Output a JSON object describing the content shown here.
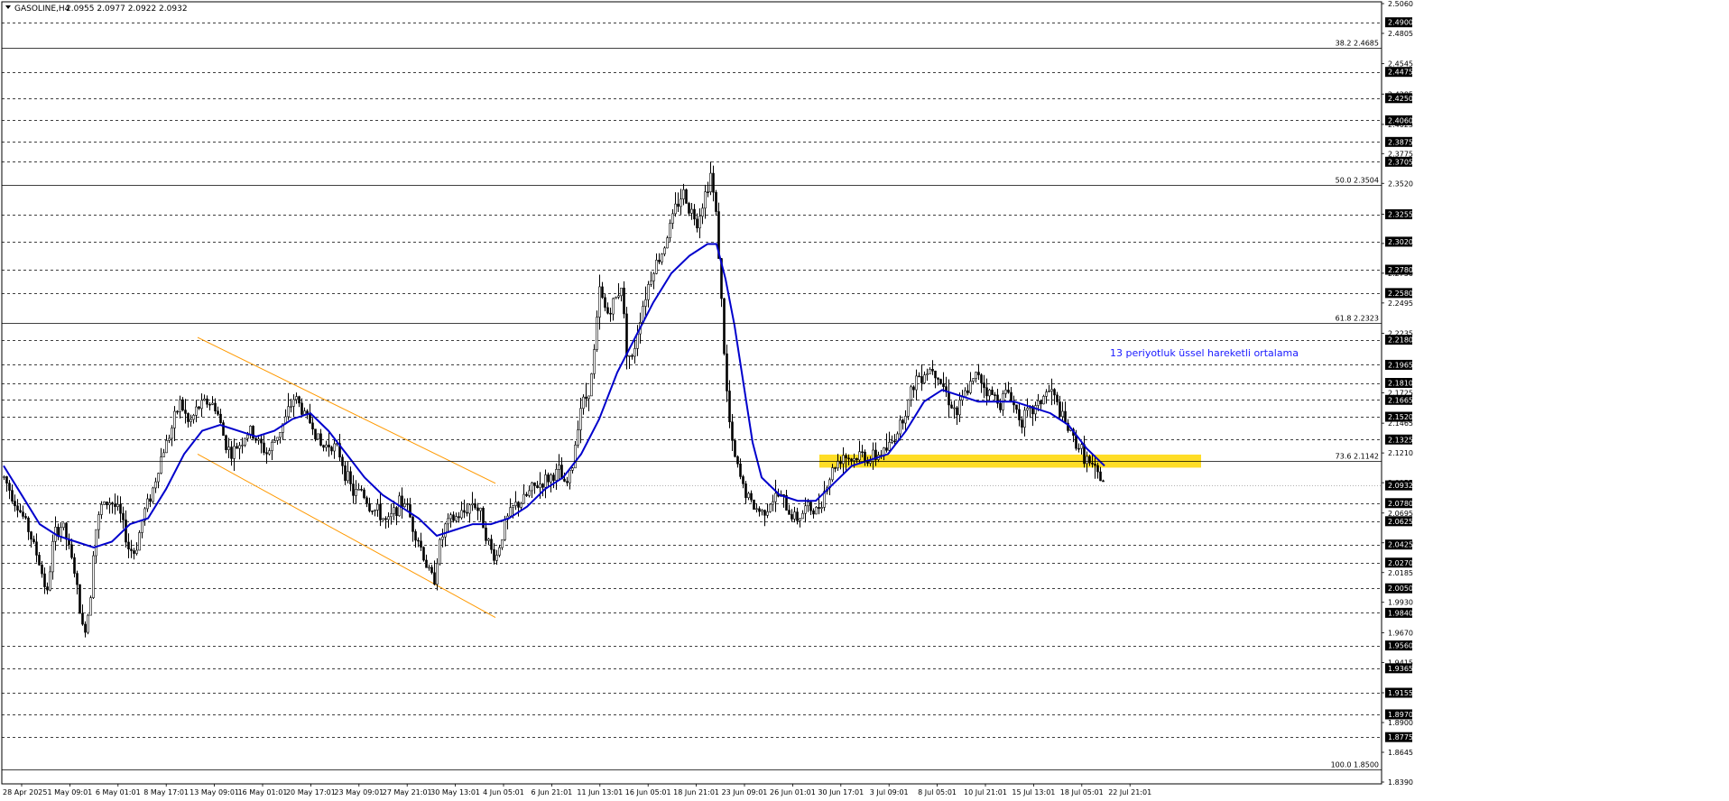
{
  "header": {
    "symbol": "GASOLINE,H4",
    "ohlc": "2.0955 2.0977 2.0922 2.0932"
  },
  "annotation_text": "13 periyotluk üssel hareketli ortalama",
  "colors": {
    "candle": "#000000",
    "ema": "#0000cc",
    "channel": "#ff9900",
    "zone": "#ffd700",
    "annotation": "#1a1aff",
    "grid": "#000000"
  },
  "chart_data": {
    "type": "candlestick",
    "symbol": "GASOLINE",
    "timeframe": "H4",
    "ylim": [
      1.839,
      2.506
    ],
    "price_axis_ticks": [
      "2.5060",
      "2.4805",
      "2.4545",
      "2.4285",
      "2.4025",
      "2.3775",
      "2.3520",
      "2.3255",
      "2.3005",
      "2.2750",
      "2.2495",
      "2.2235",
      "2.1725",
      "2.1465",
      "2.1210",
      "2.0955",
      "2.0695",
      "2.0440",
      "2.0185",
      "1.9930",
      "1.9670",
      "1.9415",
      "1.9155",
      "1.8900",
      "1.8645",
      "1.8390"
    ],
    "price_levels": [
      2.49,
      2.4475,
      2.425,
      2.406,
      2.3875,
      2.3705,
      2.3255,
      2.302,
      2.278,
      2.258,
      2.218,
      2.1965,
      2.181,
      2.1665,
      2.152,
      2.1325,
      2.078,
      2.0625,
      2.0425,
      2.027,
      2.005,
      1.984,
      1.956,
      1.9365,
      1.9155,
      1.897,
      1.8775
    ],
    "level_labels": [
      "2.4900",
      "2.4475",
      "2.4250",
      "2.4060",
      "2.3875",
      "2.3705",
      "2.3255",
      "2.3020",
      "2.2780",
      "2.2580",
      "2.2180",
      "2.1965",
      "2.1810",
      "2.1665",
      "2.1520",
      "2.1325",
      "2.0780",
      "2.0625",
      "2.0425",
      "2.0270",
      "2.0050",
      "1.9840",
      "1.9560",
      "1.9365",
      "1.9155",
      "1.8970",
      "1.8775"
    ],
    "current_price": 2.0932,
    "current_price_label": "2.0932",
    "fibonacci": [
      {
        "label": "38.2 2.4685",
        "price": 2.4685
      },
      {
        "label": "50.0 2.3504",
        "price": 2.3504
      },
      {
        "label": "61.8 2.2323",
        "price": 2.2323
      },
      {
        "label": "73.6 2.1142",
        "price": 2.1142
      },
      {
        "label": "100.0 1.8500",
        "price": 1.85
      }
    ],
    "time_labels": [
      "28 Apr 2025",
      "1 May 09:01",
      "6 May 01:01",
      "8 May 17:01",
      "13 May 09:01",
      "16 May 01:01",
      "20 May 17:01",
      "23 May 09:01",
      "27 May 21:01",
      "30 May 13:01",
      "4 Jun 05:01",
      "6 Jun 21:01",
      "11 Jun 13:01",
      "16 Jun 05:01",
      "18 Jun 21:01",
      "23 Jun 09:01",
      "26 Jun 01:01",
      "30 Jun 17:01",
      "3 Jul 09:01",
      "8 Jul 05:01",
      "10 Jul 21:01",
      "15 Jul 13:01",
      "18 Jul 05:01",
      "22 Jul 21:01"
    ],
    "price_path": [
      [
        0,
        2.1
      ],
      [
        12,
        2.08
      ],
      [
        25,
        2.06
      ],
      [
        38,
        2.03
      ],
      [
        48,
        2.0
      ],
      [
        55,
        2.05
      ],
      [
        65,
        2.06
      ],
      [
        78,
        2.02
      ],
      [
        88,
        1.965
      ],
      [
        95,
        1.99
      ],
      [
        100,
        2.05
      ],
      [
        108,
        2.075
      ],
      [
        118,
        2.08
      ],
      [
        128,
        2.07
      ],
      [
        138,
        2.04
      ],
      [
        145,
        2.035
      ],
      [
        155,
        2.07
      ],
      [
        165,
        2.09
      ],
      [
        175,
        2.12
      ],
      [
        185,
        2.14
      ],
      [
        195,
        2.165
      ],
      [
        205,
        2.145
      ],
      [
        215,
        2.16
      ],
      [
        225,
        2.165
      ],
      [
        235,
        2.16
      ],
      [
        245,
        2.13
      ],
      [
        252,
        2.12
      ],
      [
        262,
        2.13
      ],
      [
        272,
        2.14
      ],
      [
        282,
        2.13
      ],
      [
        292,
        2.12
      ],
      [
        302,
        2.135
      ],
      [
        312,
        2.15
      ],
      [
        322,
        2.17
      ],
      [
        332,
        2.155
      ],
      [
        342,
        2.145
      ],
      [
        352,
        2.125
      ],
      [
        362,
        2.13
      ],
      [
        372,
        2.12
      ],
      [
        380,
        2.1
      ],
      [
        388,
        2.085
      ],
      [
        396,
        2.09
      ],
      [
        405,
        2.075
      ],
      [
        415,
        2.07
      ],
      [
        425,
        2.06
      ],
      [
        435,
        2.075
      ],
      [
        445,
        2.08
      ],
      [
        452,
        2.06
      ],
      [
        460,
        2.045
      ],
      [
        468,
        2.025
      ],
      [
        476,
        2.01
      ],
      [
        482,
        2.04
      ],
      [
        490,
        2.06
      ],
      [
        500,
        2.065
      ],
      [
        510,
        2.07
      ],
      [
        520,
        2.08
      ],
      [
        530,
        2.065
      ],
      [
        538,
        2.04
      ],
      [
        545,
        2.03
      ],
      [
        555,
        2.06
      ],
      [
        565,
        2.075
      ],
      [
        575,
        2.08
      ],
      [
        585,
        2.09
      ],
      [
        595,
        2.095
      ],
      [
        605,
        2.1
      ],
      [
        615,
        2.105
      ],
      [
        622,
        2.09
      ],
      [
        630,
        2.11
      ],
      [
        638,
        2.16
      ],
      [
        646,
        2.17
      ],
      [
        652,
        2.19
      ],
      [
        660,
        2.26
      ],
      [
        668,
        2.24
      ],
      [
        676,
        2.25
      ],
      [
        684,
        2.265
      ],
      [
        690,
        2.21
      ],
      [
        696,
        2.2
      ],
      [
        704,
        2.235
      ],
      [
        712,
        2.26
      ],
      [
        720,
        2.28
      ],
      [
        728,
        2.29
      ],
      [
        736,
        2.31
      ],
      [
        744,
        2.33
      ],
      [
        752,
        2.345
      ],
      [
        760,
        2.33
      ],
      [
        768,
        2.32
      ],
      [
        776,
        2.34
      ],
      [
        783,
        2.36
      ],
      [
        790,
        2.32
      ],
      [
        795,
        2.25
      ],
      [
        800,
        2.18
      ],
      [
        806,
        2.13
      ],
      [
        812,
        2.11
      ],
      [
        820,
        2.09
      ],
      [
        830,
        2.075
      ],
      [
        840,
        2.07
      ],
      [
        850,
        2.08
      ],
      [
        860,
        2.085
      ],
      [
        870,
        2.07
      ],
      [
        880,
        2.065
      ],
      [
        890,
        2.075
      ],
      [
        900,
        2.07
      ],
      [
        910,
        2.09
      ],
      [
        920,
        2.11
      ],
      [
        930,
        2.12
      ],
      [
        940,
        2.115
      ],
      [
        950,
        2.12
      ],
      [
        960,
        2.115
      ],
      [
        970,
        2.12
      ],
      [
        980,
        2.125
      ],
      [
        990,
        2.14
      ],
      [
        1000,
        2.16
      ],
      [
        1010,
        2.185
      ],
      [
        1020,
        2.19
      ],
      [
        1030,
        2.195
      ],
      [
        1040,
        2.18
      ],
      [
        1048,
        2.165
      ],
      [
        1056,
        2.155
      ],
      [
        1064,
        2.17
      ],
      [
        1072,
        2.18
      ],
      [
        1080,
        2.19
      ],
      [
        1088,
        2.175
      ],
      [
        1096,
        2.17
      ],
      [
        1104,
        2.165
      ],
      [
        1112,
        2.175
      ],
      [
        1120,
        2.16
      ],
      [
        1128,
        2.15
      ],
      [
        1136,
        2.155
      ],
      [
        1144,
        2.16
      ],
      [
        1152,
        2.17
      ],
      [
        1160,
        2.175
      ],
      [
        1168,
        2.16
      ],
      [
        1176,
        2.145
      ],
      [
        1184,
        2.135
      ],
      [
        1192,
        2.125
      ],
      [
        1200,
        2.115
      ],
      [
        1208,
        2.105
      ],
      [
        1214,
        2.1
      ],
      [
        1220,
        2.095
      ]
    ],
    "ema13_path": [
      [
        0,
        2.11
      ],
      [
        20,
        2.085
      ],
      [
        40,
        2.06
      ],
      [
        60,
        2.05
      ],
      [
        80,
        2.045
      ],
      [
        100,
        2.04
      ],
      [
        120,
        2.045
      ],
      [
        140,
        2.06
      ],
      [
        160,
        2.065
      ],
      [
        180,
        2.09
      ],
      [
        200,
        2.12
      ],
      [
        220,
        2.14
      ],
      [
        240,
        2.145
      ],
      [
        260,
        2.14
      ],
      [
        280,
        2.135
      ],
      [
        300,
        2.14
      ],
      [
        320,
        2.15
      ],
      [
        340,
        2.155
      ],
      [
        360,
        2.14
      ],
      [
        380,
        2.12
      ],
      [
        400,
        2.1
      ],
      [
        420,
        2.085
      ],
      [
        440,
        2.075
      ],
      [
        460,
        2.065
      ],
      [
        480,
        2.05
      ],
      [
        500,
        2.055
      ],
      [
        520,
        2.06
      ],
      [
        540,
        2.06
      ],
      [
        560,
        2.065
      ],
      [
        580,
        2.075
      ],
      [
        600,
        2.09
      ],
      [
        620,
        2.1
      ],
      [
        640,
        2.12
      ],
      [
        660,
        2.15
      ],
      [
        680,
        2.19
      ],
      [
        700,
        2.22
      ],
      [
        720,
        2.25
      ],
      [
        740,
        2.275
      ],
      [
        760,
        2.29
      ],
      [
        780,
        2.3
      ],
      [
        790,
        2.3
      ],
      [
        800,
        2.27
      ],
      [
        810,
        2.23
      ],
      [
        820,
        2.18
      ],
      [
        830,
        2.13
      ],
      [
        840,
        2.1
      ],
      [
        860,
        2.085
      ],
      [
        880,
        2.08
      ],
      [
        900,
        2.08
      ],
      [
        920,
        2.095
      ],
      [
        940,
        2.11
      ],
      [
        960,
        2.115
      ],
      [
        980,
        2.12
      ],
      [
        1000,
        2.14
      ],
      [
        1020,
        2.165
      ],
      [
        1040,
        2.175
      ],
      [
        1060,
        2.17
      ],
      [
        1080,
        2.165
      ],
      [
        1100,
        2.165
      ],
      [
        1120,
        2.165
      ],
      [
        1140,
        2.16
      ],
      [
        1160,
        2.155
      ],
      [
        1180,
        2.145
      ],
      [
        1200,
        2.125
      ],
      [
        1220,
        2.11
      ]
    ],
    "channel_upper": [
      [
        215,
        2.22
      ],
      [
        545,
        2.095
      ]
    ],
    "channel_lower": [
      [
        215,
        2.12
      ],
      [
        545,
        1.98
      ]
    ],
    "zone": [
      2.1115,
      2.1165
    ]
  }
}
